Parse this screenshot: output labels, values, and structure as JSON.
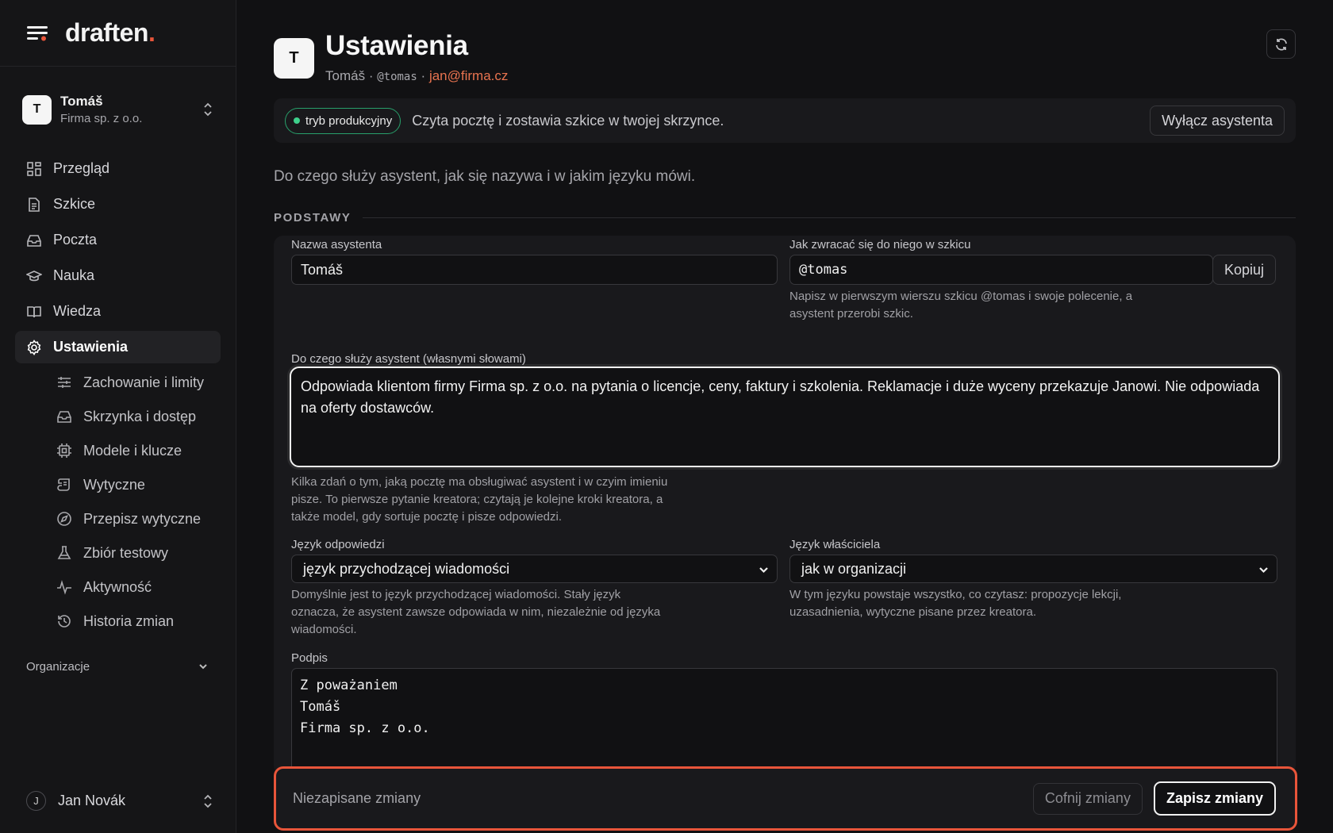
{
  "app": {
    "logo_text": "draften",
    "logo_dot": ".",
    "accent_color": "#e8553a"
  },
  "account": {
    "initial": "T",
    "name": "Tomáš",
    "org": "Firma sp. z o.o."
  },
  "nav": {
    "items": [
      {
        "label": "Przegląd",
        "icon": "grid-icon"
      },
      {
        "label": "Szkice",
        "icon": "document-icon"
      },
      {
        "label": "Poczta",
        "icon": "inbox-icon"
      },
      {
        "label": "Nauka",
        "icon": "graduation-cap-icon"
      },
      {
        "label": "Wiedza",
        "icon": "book-icon"
      },
      {
        "label": "Ustawienia",
        "icon": "gear-icon",
        "active": true
      }
    ],
    "sub_items": [
      {
        "label": "Zachowanie i limity",
        "icon": "sliders-icon"
      },
      {
        "label": "Skrzynka i dostęp",
        "icon": "inbox-icon"
      },
      {
        "label": "Modele i klucze",
        "icon": "chip-icon"
      },
      {
        "label": "Wytyczne",
        "icon": "scroll-icon"
      },
      {
        "label": "Przepisz wytyczne",
        "icon": "compass-icon"
      },
      {
        "label": "Zbiór testowy",
        "icon": "flask-icon"
      },
      {
        "label": "Aktywność",
        "icon": "activity-icon"
      },
      {
        "label": "Historia zmian",
        "icon": "history-icon"
      }
    ],
    "org_section": "Organizacje"
  },
  "user": {
    "initial": "J",
    "name": "Jan Novák"
  },
  "header": {
    "initial": "T",
    "title": "Ustawienia",
    "name": "Tomáš",
    "sep": "·",
    "handle": "@tomas",
    "email": "jan@firma.cz"
  },
  "status": {
    "badge": "tryb produkcyjny",
    "status_color": "#3ed08c",
    "text": "Czyta pocztę i zostawia szkice w twojej skrzynce.",
    "disable_label": "Wyłącz asystenta"
  },
  "intro": "Do czego służy asystent, jak się nazywa i w jakim języku mówi.",
  "section_title": "PODSTAWY",
  "form": {
    "name_label": "Nazwa asystenta",
    "name_value": "Tomáš",
    "address_label": "Jak zwracać się do niego w szkicu",
    "address_value": "@tomas",
    "copy_label": "Kopiuj",
    "address_help_1": "Napisz w pierwszym wierszu szkicu @tomas i swoje polecenie, a",
    "address_help_2": "asystent przerobi szkic.",
    "purpose_label": "Do czego służy asystent (własnymi słowami)",
    "purpose_value": "Odpowiada klientom firmy Firma sp. z o.o. na pytania o licencje, ceny, faktury i szkolenia. Reklamacje i duże wyceny przekazuje Janowi. Nie odpowiada na oferty dostawców.",
    "purpose_help_1": "Kilka zdań o tym, jaką pocztę ma obsługiwać asystent i w czyim imieniu",
    "purpose_help_2": "pisze. To pierwsze pytanie kreatora; czytają je kolejne kroki kreatora, a",
    "purpose_help_3": "także model, gdy sortuje pocztę i pisze odpowiedzi.",
    "reply_lang_label": "Język odpowiedzi",
    "reply_lang_value": "język przychodzącej wiadomości",
    "reply_lang_help_1": "Domyślnie jest to język przychodzącej wiadomości. Stały język",
    "reply_lang_help_2": "oznacza, że asystent zawsze odpowiada w nim, niezależnie od języka",
    "reply_lang_help_3": "wiadomości.",
    "owner_lang_label": "Język właściciela",
    "owner_lang_value": "jak w organizacji",
    "owner_lang_help_1": "W tym języku powstaje wszystko, co czytasz: propozycje lekcji,",
    "owner_lang_help_2": "uzasadnienia, wytyczne pisane przez kreatora.",
    "signature_label": "Podpis",
    "signature_value": "Z poważaniem\nTomáš\nFirma sp. z o.o."
  },
  "savebar": {
    "unsaved": "Niezapisane zmiany",
    "revert_label": "Cofnij zmiany",
    "save_label": "Zapisz zmiany"
  }
}
